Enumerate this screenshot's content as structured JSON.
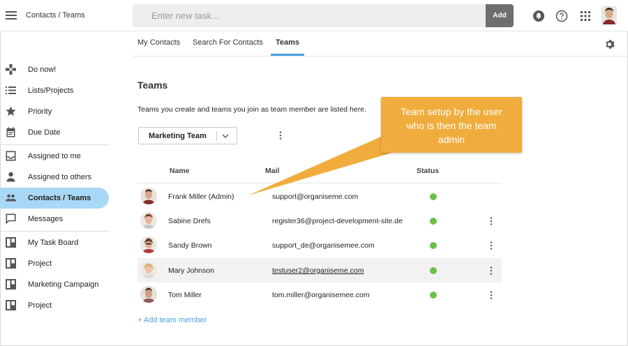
{
  "header": {
    "app_title": "Contacts / Teams",
    "task_placeholder": "Enter new task...",
    "add_label": "Add"
  },
  "tabs": [
    {
      "label": "My Contacts",
      "active": false
    },
    {
      "label": "Search For Contacts",
      "active": false
    },
    {
      "label": "Teams",
      "active": true
    }
  ],
  "sidebar": {
    "items": [
      {
        "label": "Do now!",
        "icon": "gamepad-icon"
      },
      {
        "label": "Lists/Projects",
        "icon": "list-icon"
      },
      {
        "label": "Priority",
        "icon": "star-icon"
      },
      {
        "label": "Due Date",
        "icon": "calendar-icon"
      },
      {
        "label": "Assigned to me",
        "icon": "inbox-icon"
      },
      {
        "label": "Assigned to others",
        "icon": "person-icon"
      },
      {
        "label": "Contacts / Teams",
        "icon": "people-icon",
        "active": true
      },
      {
        "label": "Messages",
        "icon": "chat-icon"
      },
      {
        "label": "My Task Board",
        "icon": "board-icon"
      },
      {
        "label": "Project",
        "icon": "board-icon"
      },
      {
        "label": "Marketing Campaign",
        "icon": "board-icon"
      },
      {
        "label": "Project",
        "icon": "board-icon"
      }
    ]
  },
  "main": {
    "title": "Teams",
    "description": "Teams you create and teams you join as team member are listed here.",
    "selected_team": "Marketing Team",
    "columns": {
      "name": "Name",
      "mail": "Mail",
      "status": "Status"
    },
    "members": [
      {
        "name": "Frank Miller (Admin)",
        "mail": "support@organiseme.com",
        "status": "online",
        "has_menu": false,
        "highlighted": false
      },
      {
        "name": "Sabine Drefs",
        "mail": "register36@project-development-site.de",
        "status": "online",
        "has_menu": true,
        "highlighted": false
      },
      {
        "name": "Sandy Brown",
        "mail": "support_de@organisemee.com",
        "status": "online",
        "has_menu": true,
        "highlighted": false
      },
      {
        "name": "Mary Johnson",
        "mail": "testuser2@organiseme.com",
        "status": "online",
        "has_menu": true,
        "highlighted": true
      },
      {
        "name": "Tom Miller",
        "mail": "tom.miller@organisemee.com",
        "status": "online",
        "has_menu": true,
        "highlighted": false
      }
    ],
    "add_member_label": "+ Add team member"
  },
  "callout": {
    "text_lines": [
      "Team setup by the user",
      "who is then the team",
      "admin"
    ]
  },
  "colors": {
    "accent": "#4aa3df",
    "active_sidebar": "#a8d8f5",
    "status_online": "#6cc04a",
    "callout": "#f0ad3d"
  }
}
